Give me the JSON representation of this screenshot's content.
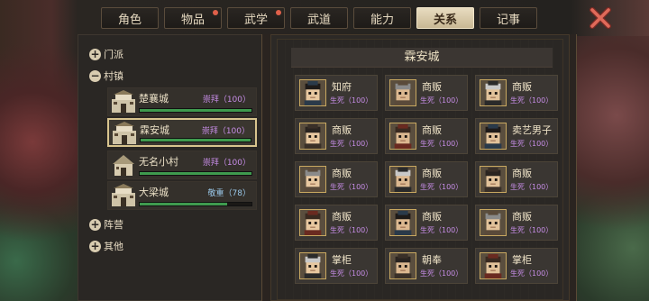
{
  "tabs": [
    {
      "label": "角色",
      "badge": false
    },
    {
      "label": "物品",
      "badge": true
    },
    {
      "label": "武学",
      "badge": true
    },
    {
      "label": "武道",
      "badge": false
    },
    {
      "label": "能力",
      "badge": false
    },
    {
      "label": "关系",
      "badge": false,
      "active": true
    },
    {
      "label": "记事",
      "badge": false
    }
  ],
  "groups": {
    "menpai": "门派",
    "cunzhen": "村镇",
    "zhenying": "阵营",
    "qita": "其他"
  },
  "towns": [
    {
      "name": "楚襄城",
      "status": "崇拜（100）",
      "level": 1.0,
      "type": "city"
    },
    {
      "name": "霖安城",
      "status": "崇拜（100）",
      "level": 1.0,
      "type": "city",
      "selected": true
    },
    {
      "name": "无名小村",
      "status": "崇拜（100）",
      "level": 1.0,
      "type": "village"
    },
    {
      "name": "大梁城",
      "status": "敬重（78）",
      "level": 0.78,
      "type": "city",
      "tone": "jing"
    }
  ],
  "detail": {
    "title": "霖安城",
    "npcs": [
      {
        "name": "知府",
        "status": "生死（100）"
      },
      {
        "name": "商贩",
        "status": "生死（100）"
      },
      {
        "name": "商贩",
        "status": "生死（100）"
      },
      {
        "name": "商贩",
        "status": "生死（100）"
      },
      {
        "name": "商贩",
        "status": "生死（100）"
      },
      {
        "name": "卖艺男子",
        "status": "生死（100）"
      },
      {
        "name": "商贩",
        "status": "生死（100）"
      },
      {
        "name": "商贩",
        "status": "生死（100）"
      },
      {
        "name": "商贩",
        "status": "生死（100）"
      },
      {
        "name": "商贩",
        "status": "生死（100）"
      },
      {
        "name": "商贩",
        "status": "生死（100）"
      },
      {
        "name": "商贩",
        "status": "生死（100）"
      },
      {
        "name": "掌柜",
        "status": "生死（100）"
      },
      {
        "name": "朝奉",
        "status": "生死（100）"
      },
      {
        "name": "掌柜",
        "status": "生死（100）"
      }
    ]
  },
  "colors": {
    "accent": "#d8c48e",
    "bar": "#3f9a4e",
    "status": "#c68ce6"
  }
}
